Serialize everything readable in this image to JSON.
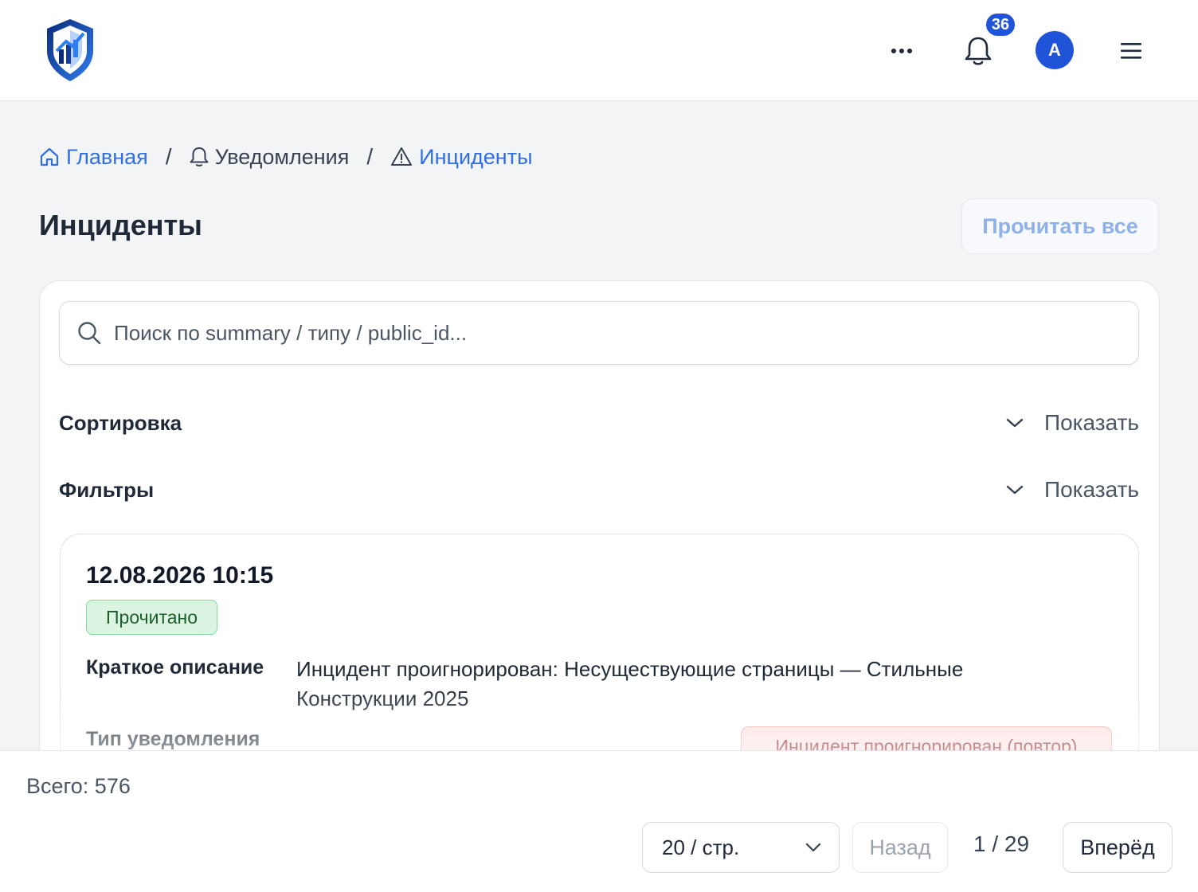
{
  "header": {
    "logo_icon": "shield-chart-logo",
    "more_icon": "more-dots-icon",
    "bell_icon": "bell-icon",
    "notification_count": "36",
    "avatar_initial": "A",
    "menu_icon": "hamburger-menu-icon"
  },
  "breadcrumb": {
    "items": [
      {
        "icon": "home-icon",
        "label": "Главная"
      },
      {
        "icon": "bell-icon",
        "label": "Уведомления"
      },
      {
        "icon": "warning-icon",
        "label": "Инциденты"
      }
    ],
    "separator": "/"
  },
  "page": {
    "title": "Инциденты",
    "read_all_label": "Прочитать все"
  },
  "search": {
    "placeholder": "Поиск по summary / типу / public_id..."
  },
  "sections": {
    "sort_label": "Сортировка",
    "filters_label": "Фильтры",
    "show_label": "Показать"
  },
  "incident": {
    "datetime": "12.08.2026 10:15",
    "status": "Прочитано",
    "summary_label": "Краткое описание",
    "summary_value": "Инцидент проигнорирован: Несуществующие страницы — Стильные Конструкции 2025",
    "type_label": "Тип уведомления",
    "type_value": "Инцидент проигнорирован (повтор)"
  },
  "footer": {
    "total": "Всего: 576",
    "per_page": "20 / стр.",
    "back_label": "Назад",
    "page_indicator": "1 / 29",
    "next_label": "Вперёд"
  },
  "colors": {
    "accent": "#2054d8",
    "link": "#2f6fe4",
    "status_read_bg": "#dcf5e2",
    "type_badge_bg": "#fde0e0"
  }
}
